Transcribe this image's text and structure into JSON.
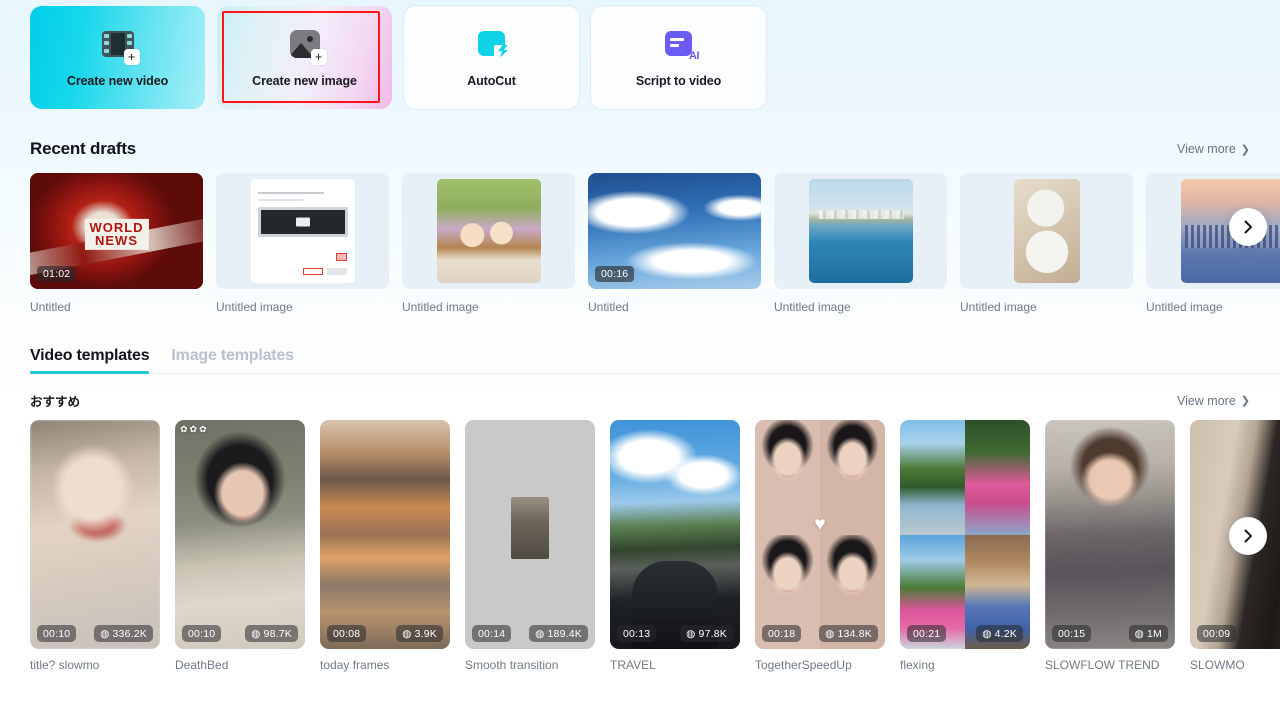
{
  "actions": [
    {
      "label": "Create new video",
      "icon": "film-plus-icon",
      "style": "gradient-cyan",
      "selected": false
    },
    {
      "label": "Create new image",
      "icon": "photo-plus-icon",
      "style": "gradient-pink",
      "selected": true
    },
    {
      "label": "AutoCut",
      "icon": "autocut-lightning-icon",
      "style": "plain",
      "selected": false
    },
    {
      "label": "Script to video",
      "icon": "script-ai-icon",
      "style": "plain",
      "selected": false
    }
  ],
  "recent_drafts": {
    "title": "Recent drafts",
    "view_more": "View more",
    "items": [
      {
        "name": "Untitled",
        "duration": "01:02",
        "art": "art-news",
        "fit": "full"
      },
      {
        "name": "Untitled image",
        "duration": "",
        "art": "art-dialog",
        "fit": "wide"
      },
      {
        "name": "Untitled image",
        "duration": "",
        "art": "art-girls",
        "fit": "wide"
      },
      {
        "name": "Untitled",
        "duration": "00:16",
        "art": "art-sky",
        "fit": "full"
      },
      {
        "name": "Untitled image",
        "duration": "",
        "art": "art-harbor",
        "fit": "wide"
      },
      {
        "name": "Untitled image",
        "duration": "",
        "art": "art-food",
        "fit": "narrow"
      },
      {
        "name": "Untitled image",
        "duration": "",
        "art": "art-city",
        "fit": "wide"
      }
    ]
  },
  "templates_section": {
    "tabs": [
      {
        "label": "Video templates",
        "active": true
      },
      {
        "label": "Image templates",
        "active": false
      }
    ],
    "subtitle": "おすすめ",
    "view_more": "View more",
    "items": [
      {
        "name": "title? slowmo",
        "duration": "00:10",
        "uses": "336.2K",
        "art": "a-girl1",
        "stars": 0,
        "hearted": false
      },
      {
        "name": "DeathBed",
        "duration": "00:10",
        "uses": "98.7K",
        "art": "a-girl2",
        "stars": 3,
        "hearted": false
      },
      {
        "name": "today frames",
        "duration": "00:08",
        "uses": "3.9K",
        "art": "a-shop",
        "stars": 0,
        "hearted": false
      },
      {
        "name": "Smooth transition",
        "duration": "00:14",
        "uses": "189.4K",
        "art": "a-gray",
        "stars": 0,
        "hearted": false
      },
      {
        "name": "TRAVEL",
        "duration": "00:13",
        "uses": "97.8K",
        "art": "a-road",
        "stars": 0,
        "hearted": false
      },
      {
        "name": "TogetherSpeedUp",
        "duration": "00:18",
        "uses": "134.8K",
        "art": "a-faces",
        "stars": 0,
        "hearted": true
      },
      {
        "name": "flexing",
        "duration": "00:21",
        "uses": "4.2K",
        "art": "a-grid4",
        "stars": 0,
        "hearted": false
      },
      {
        "name": "SLOWFLOW TREND",
        "duration": "00:15",
        "uses": "1M",
        "art": "a-coat",
        "stars": 0,
        "hearted": false
      },
      {
        "name": "SLOWMO",
        "duration": "00:09",
        "uses": "",
        "art": "a-hair",
        "stars": 0,
        "hearted": false
      }
    ]
  },
  "icons": {
    "chevron_right": "›",
    "fire": "◍",
    "star": "✿",
    "heart": "♥",
    "plus": "+"
  },
  "colors": {
    "accent_cyan": "#1ec6de",
    "selection_red": "#ff1515",
    "script_purple": "#6a5cf0",
    "text_primary": "#14141c",
    "text_muted": "#707a86"
  }
}
